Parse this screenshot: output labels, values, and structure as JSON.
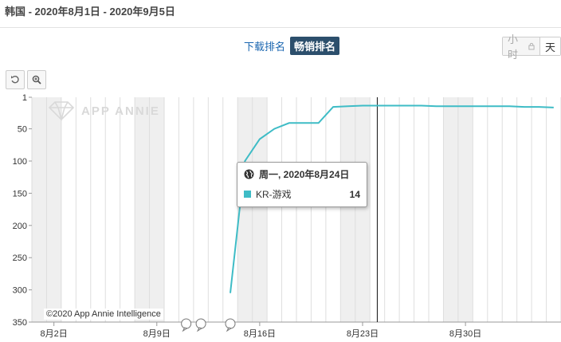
{
  "header": {
    "title": "韩国 - 2020年8月1日 - 2020年9月5日"
  },
  "ranking_tabs": {
    "download_label": "下载排名",
    "grossing_label": "畅销排名"
  },
  "granularity": {
    "hour_label": "小时",
    "day_label": "天"
  },
  "toolbar": {
    "reset_icon": "undo-icon",
    "zoom_icon": "zoom-in-icon"
  },
  "watermark": {
    "text": "APP ANNIE",
    "icon": "diamond-logo-icon"
  },
  "copyright": "©2020 App Annie Intelligence",
  "tooltip": {
    "date": "周一, 2020年8月24日",
    "series_name": "KR-游戏",
    "value": "14",
    "icon": "globe-icon"
  },
  "colors": {
    "series": "#3ebcc6",
    "weekend_band": "#efefef",
    "active_tab": "#2c4f6c"
  },
  "chart_data": {
    "type": "line",
    "title": "",
    "xlabel": "",
    "ylabel": "",
    "y_inverted": true,
    "ylim": [
      1,
      350
    ],
    "yticks": [
      1,
      50,
      100,
      150,
      200,
      250,
      300,
      350
    ],
    "xlim": [
      "2020-08-01",
      "2020-09-05"
    ],
    "xticks": [
      {
        "date": "2020-08-02",
        "label": "8月2日"
      },
      {
        "date": "2020-08-09",
        "label": "8月9日"
      },
      {
        "date": "2020-08-16",
        "label": "8月16日"
      },
      {
        "date": "2020-08-23",
        "label": "8月23日"
      },
      {
        "date": "2020-08-30",
        "label": "8月30日"
      }
    ],
    "grid": true,
    "weekend_bands": [
      [
        "2020-08-01",
        "2020-08-02"
      ],
      [
        "2020-08-08",
        "2020-08-09"
      ],
      [
        "2020-08-15",
        "2020-08-16"
      ],
      [
        "2020-08-22",
        "2020-08-23"
      ],
      [
        "2020-08-29",
        "2020-08-30"
      ]
    ],
    "crosshair_date": "2020-08-24",
    "event_marker_dates": [
      "2020-08-11",
      "2020-08-12",
      "2020-08-14"
    ],
    "series": [
      {
        "name": "KR-游戏",
        "x": [
          "2020-08-14",
          "2020-08-15",
          "2020-08-16",
          "2020-08-17",
          "2020-08-18",
          "2020-08-19",
          "2020-08-20",
          "2020-08-21",
          "2020-08-22",
          "2020-08-23",
          "2020-08-24",
          "2020-08-25",
          "2020-08-26",
          "2020-08-27",
          "2020-08-28",
          "2020-08-29",
          "2020-08-30",
          "2020-08-31",
          "2020-09-01",
          "2020-09-02",
          "2020-09-03",
          "2020-09-04",
          "2020-09-05"
        ],
        "y": [
          305,
          100,
          66,
          50,
          41,
          41,
          41,
          16,
          15,
          14,
          14,
          14,
          14,
          14,
          15,
          15,
          15,
          15,
          15,
          15,
          16,
          16,
          17
        ]
      }
    ]
  }
}
